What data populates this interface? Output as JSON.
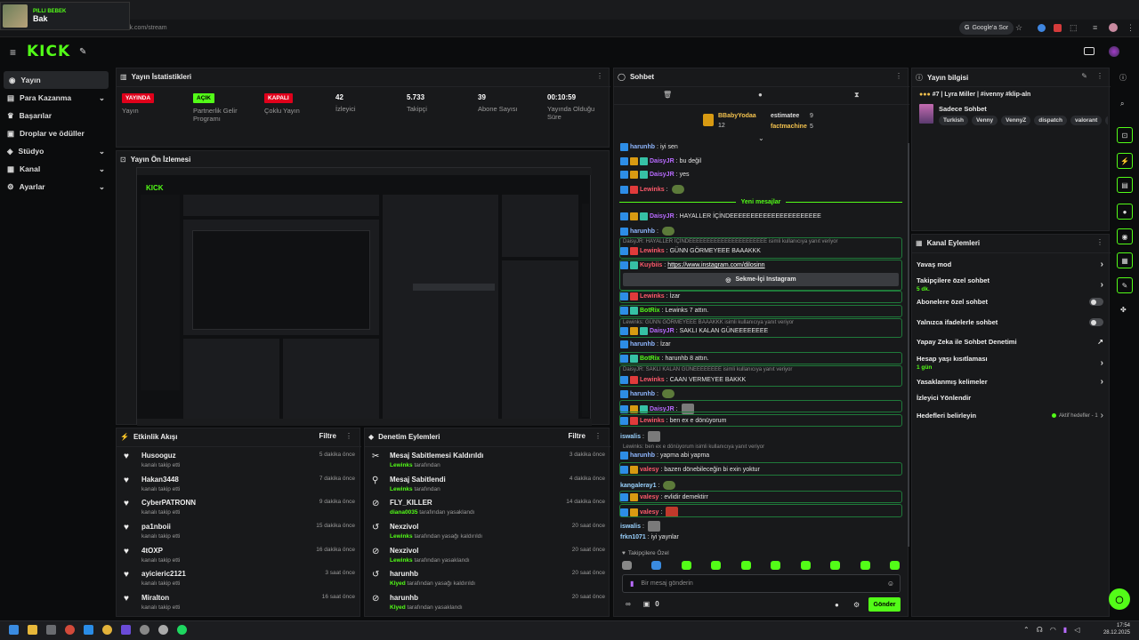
{
  "browser": {
    "notification_title": "PILLI BEBEK",
    "notification_text": "Bak",
    "url": "dashboard.kick.com/stream",
    "google_label": "Google'a Sor"
  },
  "kick": {
    "logo": "KICK"
  },
  "sidebar": {
    "items": [
      {
        "label": "Yayın",
        "active": true,
        "chev": false
      },
      {
        "label": "Para Kazanma",
        "active": false,
        "chev": true
      },
      {
        "label": "Başarılar",
        "active": false,
        "chev": false
      },
      {
        "label": "Droplar ve ödüller",
        "active": false,
        "chev": false
      },
      {
        "label": "Stüdyo",
        "active": false,
        "chev": true
      },
      {
        "label": "Kanal",
        "active": false,
        "chev": true
      },
      {
        "label": "Ayarlar",
        "active": false,
        "chev": true
      }
    ]
  },
  "stats": {
    "title": "Yayın İstatistikleri",
    "items": [
      {
        "badge": "YAYINDA",
        "badge_color": "red",
        "label": "Yayın"
      },
      {
        "badge": "AÇIK",
        "badge_color": "green",
        "label": "Partnerlik Gelir Programı"
      },
      {
        "badge": "KAPALI",
        "badge_color": "red",
        "label": "Çoklu Yayın"
      },
      {
        "value": "42",
        "label": "İzleyici"
      },
      {
        "value": "5.733",
        "label": "Takipçi"
      },
      {
        "value": "39",
        "label": "Abone Sayısı"
      },
      {
        "value": "00:10:59",
        "label": "Yayında Olduğu Süre"
      }
    ]
  },
  "preview": {
    "title": "Yayın Ön İzlemesi"
  },
  "events": {
    "title": "Etkinlik Akışı",
    "filter": "Filtre",
    "items": [
      {
        "name": "Husooguz",
        "sub": "kanalı takip etti",
        "time": "5 dakika önce"
      },
      {
        "name": "Hakan3448",
        "sub": "kanalı takip etti",
        "time": "7 dakika önce"
      },
      {
        "name": "CyberPATRONN",
        "sub": "kanalı takip etti",
        "time": "9 dakika önce"
      },
      {
        "name": "pa1nboii",
        "sub": "kanalı takip etti",
        "time": "15 dakika önce"
      },
      {
        "name": "4tOXP",
        "sub": "kanalı takip etti",
        "time": "16 dakika önce"
      },
      {
        "name": "ayicieric2121",
        "sub": "kanalı takip etti",
        "time": "3 saat önce"
      },
      {
        "name": "Miralton",
        "sub": "kanalı takip etti",
        "time": "16 saat önce"
      }
    ]
  },
  "mod": {
    "title": "Denetim Eylemleri",
    "filter": "Filtre",
    "items": [
      {
        "title": "Mesaj Sabitlemesi Kaldırıldı",
        "user": "Lewinks",
        "rest": "tarafından",
        "time": "3 dakika önce"
      },
      {
        "title": "Mesaj Sabitlendi",
        "user": "Lewinks",
        "rest": "tarafından",
        "time": "4 dakika önce"
      },
      {
        "title": "FLY_KILLER",
        "user": "diana0035",
        "rest": "tarafından yasaklandı",
        "time": "14 dakika önce"
      },
      {
        "title": "Nexzivol",
        "user": "Lewinks",
        "rest": "tarafından yasağı kaldırıldı",
        "time": "20 saat önce"
      },
      {
        "title": "Nexzivol",
        "user": "Lewinks",
        "rest": "tarafından yasaklandı",
        "time": "20 saat önce"
      },
      {
        "title": "harunhb",
        "user": "Klyed",
        "rest": "tarafından yasağı kaldırıldı",
        "time": "20 saat önce"
      },
      {
        "title": "harunhb",
        "user": "Klyed",
        "rest": "tarafından yasaklandı",
        "time": "20 saat önce"
      }
    ]
  },
  "chat": {
    "title": "Sohbet",
    "top_gifter": "BBabyYodaa",
    "top_gifter_count": "12",
    "gifter2": "estimatee",
    "gifter2_count": "9",
    "gifter3": "factmachine",
    "gifter3_count": "5",
    "new_messages": "Yeni mesajlar",
    "reply1": "DaisyJR: HAYALLER İÇİNDEEEEEEEEEEEEEEEEEEEEEE isimli kullanıcıya yanıt veriyor",
    "reply2": "Lewinks: GÜNN GÖRMEYEEE BAAAKKK isimli kullanıcıya yanıt veriyor",
    "reply3": "DaisyJR: SAKLI KALAN GÜNEEEEEEEE isimli kullanıcıya yanıt veriyor",
    "reply4": "Lewinks: ben ex e dönüyorum isimli kullanıcıya yanıt veriyor",
    "insta_button": "Sekme-İçi Instagram",
    "followers_only": "Takipçilere Özel",
    "input_placeholder": "Bir mesaj gönderin",
    "send": "Gönder",
    "count": "0",
    "messages": [
      {
        "u": "harunhb",
        "c": "#8fb7ff",
        "t": "iyi sen"
      },
      {
        "u": "DaisyJR",
        "c": "#b86bff",
        "t": "bu değil"
      },
      {
        "u": "DaisyJR",
        "c": "#b86bff",
        "t": "yes"
      },
      {
        "u": "Lewinks",
        "c": "#ff5a6b",
        "t": ""
      },
      {
        "u": "DaisyJR",
        "c": "#b86bff",
        "t": "HAYALLER İÇİNDEEEEEEEEEEEEEEEEEEEEEE"
      },
      {
        "u": "harunhb",
        "c": "#8fb7ff",
        "t": ""
      },
      {
        "u": "Lewinks",
        "c": "#ff5a6b",
        "t": "GÜNN GÖRMEYEEE BAAAKKK"
      },
      {
        "u": "Kuybiis",
        "c": "#ff5a6b",
        "t": "https://www.instagram.com/dilosinn"
      },
      {
        "u": "Lewinks",
        "c": "#ff5a6b",
        "t": "İzar"
      },
      {
        "u": "BotRix",
        "c": "#53fc18",
        "t": "Lewinks 7 attın."
      },
      {
        "u": "DaisyJR",
        "c": "#b86bff",
        "t": "SAKLI KALAN GÜNEEEEEEEE"
      },
      {
        "u": "harunhb",
        "c": "#8fb7ff",
        "t": "İzar"
      },
      {
        "u": "BotRix",
        "c": "#53fc18",
        "t": "harunhb 8 attın."
      },
      {
        "u": "Lewinks",
        "c": "#ff5a6b",
        "t": "CAAN VERMEYEE BAKKK"
      },
      {
        "u": "harunhb",
        "c": "#8fb7ff",
        "t": ""
      },
      {
        "u": "DaisyJR",
        "c": "#b86bff",
        "t": ""
      },
      {
        "u": "Lewinks",
        "c": "#ff5a6b",
        "t": "ben ex e dönüyorum"
      },
      {
        "u": "iswalis",
        "c": "#9ad2ff",
        "t": ""
      },
      {
        "u": "harunhb",
        "c": "#8fb7ff",
        "t": "yapma abi yapma"
      },
      {
        "u": "valesy",
        "c": "#ff5a6b",
        "t": "bazen dönebileceğin bi exin yoktur"
      },
      {
        "u": "kangaleray1",
        "c": "#9ad2ff",
        "t": ""
      },
      {
        "u": "valesy",
        "c": "#ff5a6b",
        "t": "evlidir demektirr"
      },
      {
        "u": "valesy",
        "c": "#ff5a6b",
        "t": ""
      },
      {
        "u": "iswalis",
        "c": "#9ad2ff",
        "t": ""
      },
      {
        "u": "frkn1071",
        "c": "#9ad2ff",
        "t": "iyi yaynlar"
      }
    ]
  },
  "stream_info": {
    "title": "Yayın bilgisi",
    "stream_title": "#7 | Lyra Miller | #ivenny #klip-aln",
    "category": "Sadece Sohbet",
    "tags": [
      "Turkish",
      "Venny",
      "VennyZ",
      "dispatch",
      "valorant",
      "ven"
    ]
  },
  "channel_actions": {
    "title": "Kanal Eylemleri",
    "items": [
      {
        "label": "Yavaş mod",
        "sub": "",
        "ctrl": "chev"
      },
      {
        "label": "Takipçilere özel sohbet",
        "sub": "5 dk.",
        "ctrl": "chev"
      },
      {
        "label": "Abonelere özel sohbet",
        "sub": "",
        "ctrl": "toggle"
      },
      {
        "label": "Yalnızca ifadelerle sohbet",
        "sub": "",
        "ctrl": "toggle"
      },
      {
        "label": "Yapay Zeka ile Sohbet Denetimi",
        "sub": "",
        "ctrl": "ext"
      },
      {
        "label": "Hesap yaşı kısıtlaması",
        "sub": "1 gün",
        "ctrl": "chev"
      },
      {
        "label": "Yasaklanmış kelimeler",
        "sub": "",
        "ctrl": "chev"
      },
      {
        "label": "İzleyici Yönlendir",
        "sub": "",
        "ctrl": "none"
      },
      {
        "label": "Hedefleri belirleyin",
        "sub": "",
        "ctrl": "goal",
        "goal": "Aktif hedefler - 1"
      }
    ]
  },
  "taskbar": {
    "time": "17:54",
    "date": "28.12.2025"
  },
  "colors": {
    "accent": "#53fc18",
    "live": "#e0001b",
    "panel": "#18191b"
  }
}
